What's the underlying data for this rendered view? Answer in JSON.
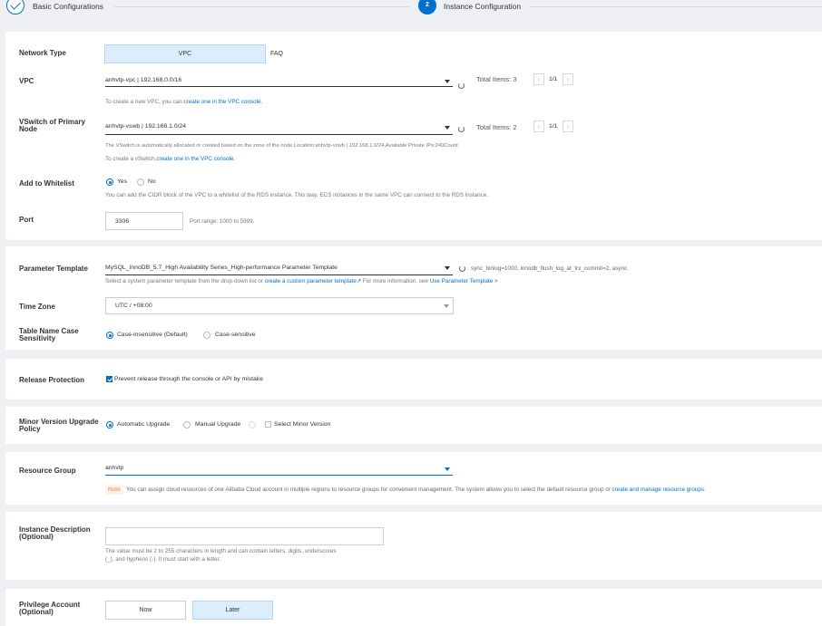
{
  "steps": {
    "step1_label": "Basic Configurations",
    "step2_number": "2",
    "step2_label": "Instance Configuration"
  },
  "network": {
    "network_type_label": "Network Type",
    "network_type_value": "VPC",
    "faq": "FAQ",
    "vpc_label": "VPC",
    "vpc_value": "anhvtp-vpc | 192.168.0.0/16",
    "vpc_total": "Total Items: 3",
    "vpc_page": "1/1",
    "vpc_help_prefix": "To create a new VPC, you can",
    "vpc_help_link": "create one in the VPC console.",
    "vswitch_label": "VSwitch of Primary Node",
    "vswitch_value": "anhvtp-vswb | 192.168.1.0/24",
    "vswitch_total": "Total Items: 2",
    "vswitch_page": "1/1",
    "vswitch_help1": "The VSwitch is automatically allocated or created based on the zone of the node.Location:anhvtp-vswb | 192.168.1.0/24,Available Private IPs:249Count",
    "vswitch_help2_prefix": "To create a vSwitch,",
    "vswitch_help2_link": "create one in the VPC console.",
    "whitelist_label": "Add to Whitelist",
    "whitelist_yes": "Yes",
    "whitelist_no": "No",
    "whitelist_selected": "Yes",
    "whitelist_help": "You can add the CIDR block of the VPC to a whitelist of the RDS instance. This way, ECS instances in the same VPC can connect to the RDS instance.",
    "port_label": "Port",
    "port_value": "3306",
    "port_help": "Port range: 1000 to 5999."
  },
  "params": {
    "template_label": "Parameter Template",
    "template_value": "MySQL_InnoDB_5.7_High Availability Series_High-performance Parameter Template",
    "template_summary": "sync_binlog=1000, innodb_flush_log_at_trx_commit=2, async",
    "template_help_prefix": "Select a system parameter template from the drop-down list or",
    "template_help_link": "create a custom parameter template",
    "template_help_mid": "For more information, see",
    "template_help_link2": "Use Parameter Template >",
    "timezone_label": "Time Zone",
    "timezone_value": "UTC / +08:00",
    "case_label": "Table Name Case Sensitivity",
    "case_insensitive": "Case-insensitive (Default)",
    "case_sensitive": "Case-sensitive",
    "case_selected": "Case-insensitive (Default)"
  },
  "release": {
    "label": "Release Protection",
    "checkbox_label": "Prevent release through the console or API by mistake",
    "checked": true
  },
  "upgrade": {
    "label": "Minor Version Upgrade Policy",
    "automatic": "Automatic Upgrade",
    "manual": "Manual Upgrade",
    "select_minor": "Select Minor Version",
    "selected": "Automatic Upgrade"
  },
  "resource": {
    "label": "Resource Group",
    "value": "anhvtp",
    "note_tag": "Note",
    "note_text": "You can assign cloud resources of one Alibaba Cloud account in multiple regions to resource groups for convenient management. The system allows you to select the default resource group or",
    "note_link": "create and manage resource groups."
  },
  "description": {
    "label": "Instance Description (Optional)",
    "value": "",
    "help1": "The value must be 2 to 255 characters in length and can contain letters, digits, underscores",
    "help2": "(_), and hyphens (-). It must start with a letter."
  },
  "privilege": {
    "label": "Privilege Account (Optional)",
    "now": "Now",
    "later": "Later",
    "selected": "Later"
  },
  "colors": {
    "accent": "#0070cc",
    "selected_fill": "#dceefb",
    "note_bg": "#fff2e8",
    "note_fg": "#f0823a",
    "page_bg": "#eef0f3"
  }
}
